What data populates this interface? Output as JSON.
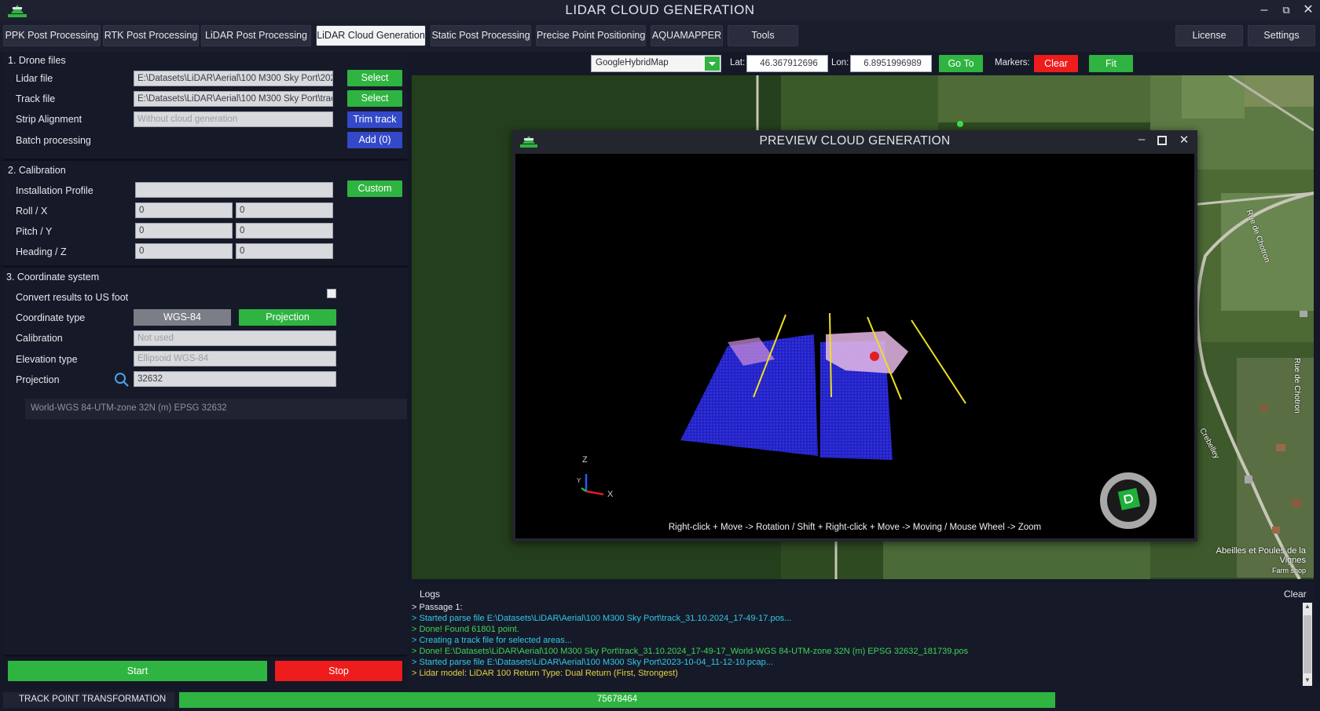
{
  "window": {
    "title": "LIDAR CLOUD GENERATION"
  },
  "tabs": [
    "PPK Post Processing",
    "RTK Post Processing",
    "LiDAR Post Processing",
    "LiDAR Cloud Generation",
    "Static Post Processing",
    "Precise Point Positioning",
    "AQUAMAPPER",
    "Tools"
  ],
  "right_tabs": [
    "License",
    "Settings"
  ],
  "drone_files": {
    "title": "1. Drone files",
    "lidar_label": "Lidar file",
    "lidar_value": "E:\\Datasets\\LiDAR\\Aerial\\100 M300 Sky Port\\202",
    "track_label": "Track file",
    "track_value": "E:\\Datasets\\LiDAR\\Aerial\\100 M300 Sky Port\\trac",
    "select_label": "Select",
    "strip_label": "Strip Alignment",
    "strip_placeholder": "Without cloud generation",
    "trim_label": "Trim track",
    "batch_label": "Batch processing",
    "add_label": "Add (0)"
  },
  "calibration": {
    "title": "2. Calibration",
    "profile_label": "Installation Profile",
    "custom_label": "Custom",
    "roll_label": "Roll / X",
    "pitch_label": "Pitch / Y",
    "heading_label": "Heading / Z",
    "zero": "0"
  },
  "coord": {
    "title": "3. Coordinate system",
    "usfoot_label": "Convert results to US foot",
    "type_label": "Coordinate type",
    "wgs_label": "WGS-84",
    "projection_btn": "Projection",
    "calibration_label": "Calibration",
    "calibration_placeholder": "Not used",
    "elevation_label": "Elevation type",
    "elevation_placeholder": "Ellipsoid WGS-84",
    "projection_label": "Projection",
    "projection_value": "32632",
    "projection_desc": "World-WGS 84-UTM-zone 32N (m) EPSG 32632"
  },
  "actions": {
    "start": "Start",
    "stop": "Stop"
  },
  "mapbar": {
    "map_type": "GoogleHybridMap",
    "lat_label": "Lat:",
    "lat_value": "46.367912696",
    "lon_label": "Lon:",
    "lon_value": "6.8951996989",
    "goto": "Go To",
    "markers_label": "Markers:",
    "clear": "Clear",
    "fit": "Fit"
  },
  "map_labels": {
    "road1": "Rue de Chotron",
    "road2": "Rue de Chotron",
    "road3": "Crebelley",
    "poi": "Abeilles et Poules de la Vignes",
    "poi_sub": "Farm shop"
  },
  "preview": {
    "title": "PREVIEW CLOUD GENERATION",
    "axis_z": "Z",
    "axis_x": "X",
    "axis_y": "Y",
    "hint": "Right-click + Move -> Rotation /  Shift + Right-click + Move -> Moving / Mouse Wheel -> Zoom"
  },
  "logs": {
    "title": "Logs",
    "clear": "Clear",
    "lines": [
      {
        "text": "> Passage 1:",
        "color": "#e6e8ee"
      },
      {
        "text": "> Started parse file  E:\\Datasets\\LiDAR\\Aerial\\100 M300 Sky Port\\track_31.10.2024_17-49-17.pos...",
        "color": "#32c8e6"
      },
      {
        "text": "> Done! Found 61801 point.",
        "color": "#3fd25a"
      },
      {
        "text": "> Creating a track file for selected areas...",
        "color": "#32c8e6"
      },
      {
        "text": "> Done! E:\\Datasets\\LiDAR\\Aerial\\100 M300 Sky Port\\track_31.10.2024_17-49-17_World-WGS 84-UTM-zone 32N (m) EPSG 32632_181739.pos",
        "color": "#3fd25a"
      },
      {
        "text": "> Started parse file E:\\Datasets\\LiDAR\\Aerial\\100 M300 Sky Port\\2023-10-04_11-12-10.pcap...",
        "color": "#32c8e6"
      },
      {
        "text": "> Lidar model: LiDAR 100  Return Type: Dual Return (First, Strongest)",
        "color": "#e6d23c"
      }
    ]
  },
  "status": {
    "label": "TRACK POINT TRANSFORMATION",
    "value": "75678464",
    "progress": 0.77
  },
  "colors": {
    "accent_green": "#2fb441",
    "accent_blue": "#3349c9",
    "accent_red": "#ee1c1c"
  }
}
